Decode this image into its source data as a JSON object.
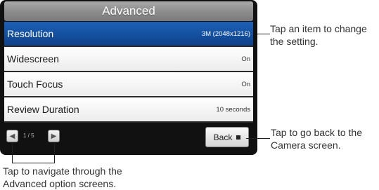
{
  "screen": {
    "title": "Advanced",
    "rows": [
      {
        "label": "Resolution",
        "value": "3M (2048x1216)",
        "selected": true
      },
      {
        "label": "Widescreen",
        "value": "On",
        "selected": false
      },
      {
        "label": "Touch Focus",
        "value": "On",
        "selected": false
      },
      {
        "label": "Review Duration",
        "value": "10 seconds",
        "selected": false
      }
    ],
    "pager": {
      "prev_icon": "chevron-left-icon",
      "next_icon": "chevron-right-icon",
      "indicator": "1 / 5"
    },
    "back_label": "Back"
  },
  "callouts": {
    "item": "Tap an item to change the setting.",
    "back": "Tap to go back to the Camera screen.",
    "navigate": "Tap to navigate through the Advanced option screens."
  },
  "colors": {
    "selected_row": "#14509f",
    "frame": "#111111"
  }
}
